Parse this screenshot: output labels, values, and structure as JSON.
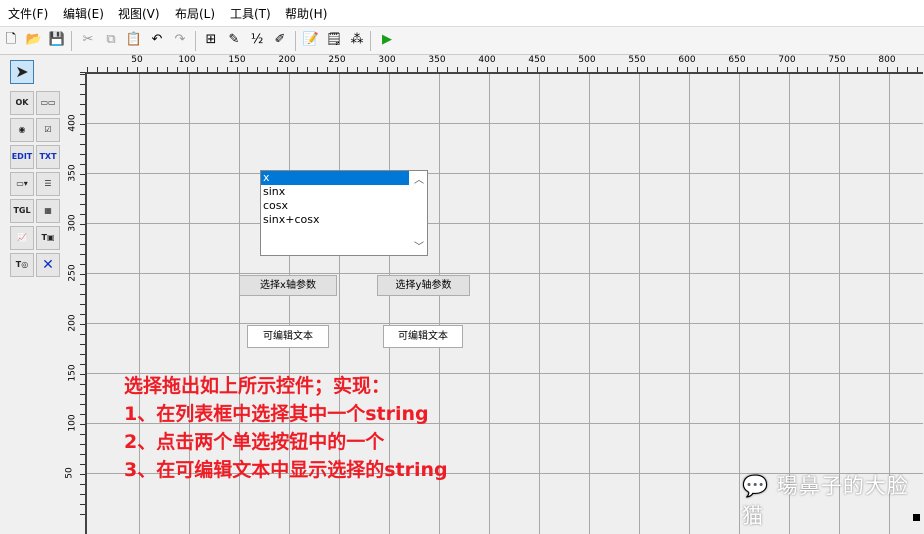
{
  "menu": [
    "文件(F)",
    "编辑(E)",
    "视图(V)",
    "布局(L)",
    "工具(T)",
    "帮助(H)"
  ],
  "toolbar": [
    {
      "icon": "new-file-icon",
      "g": "🗋"
    },
    {
      "icon": "open-folder-icon",
      "g": "📂"
    },
    {
      "icon": "save-icon",
      "g": "💾"
    },
    {
      "icon": "cut-icon",
      "g": "✂"
    },
    {
      "icon": "copy-icon",
      "g": "⧉"
    },
    {
      "icon": "paste-icon",
      "g": "📋"
    },
    {
      "icon": "undo-icon",
      "g": "↶"
    },
    {
      "icon": "redo-icon",
      "g": "↷"
    },
    {
      "icon": "align-icon",
      "g": "⊞"
    },
    {
      "icon": "menu-editor-icon",
      "g": "✎"
    },
    {
      "icon": "tab-order-icon",
      "g": "½"
    },
    {
      "icon": "toolbar-editor-icon",
      "g": "✐"
    },
    {
      "icon": "editor-icon",
      "g": "📝"
    },
    {
      "icon": "property-inspector-icon",
      "g": "🗒"
    },
    {
      "icon": "object-browser-icon",
      "g": "⁂"
    },
    {
      "icon": "run-icon",
      "g": "▶"
    }
  ],
  "palette": [
    {
      "n": "push-button",
      "t": "OK"
    },
    {
      "n": "slider",
      "t": "▭▭"
    },
    {
      "n": "radio-button",
      "t": "◉"
    },
    {
      "n": "checkbox",
      "t": "☑"
    },
    {
      "n": "edit-text",
      "t": "EDIT"
    },
    {
      "n": "static-text",
      "t": "TXT"
    },
    {
      "n": "popup-menu",
      "t": "▭▾"
    },
    {
      "n": "listbox",
      "t": "☰"
    },
    {
      "n": "toggle-button",
      "t": "TGL"
    },
    {
      "n": "table",
      "t": "▦"
    },
    {
      "n": "axes",
      "t": "📈"
    },
    {
      "n": "panel",
      "t": "T▣"
    },
    {
      "n": "button-group",
      "t": "T◎"
    },
    {
      "n": "activex",
      "t": "✕"
    }
  ],
  "hruler": [
    50,
    100,
    150,
    200,
    250,
    300,
    350,
    400,
    450,
    500,
    550,
    600,
    650,
    700,
    750,
    800
  ],
  "vruler": [
    400,
    350,
    300,
    250,
    200,
    150,
    100,
    50
  ],
  "listbox": {
    "items": [
      "x",
      "sinx",
      "cosx",
      "sinx+cosx"
    ],
    "selected": 0
  },
  "buttons": [
    "选择x轴参数",
    "选择y轴参数"
  ],
  "edits": [
    "可编辑文本",
    "可编辑文本"
  ],
  "note": [
    "选择拖出如上所示控件；实现：",
    "1、在列表框中选择其中一个string",
    "2、点击两个单选按钮中的一个",
    "3、在可编辑文本中显示选择的string"
  ],
  "watermark": "瑒鼻子的大脸猫",
  "colors": {
    "selection": "#0078d7",
    "note": "#ee1c25",
    "run": "#1a9e1a"
  }
}
